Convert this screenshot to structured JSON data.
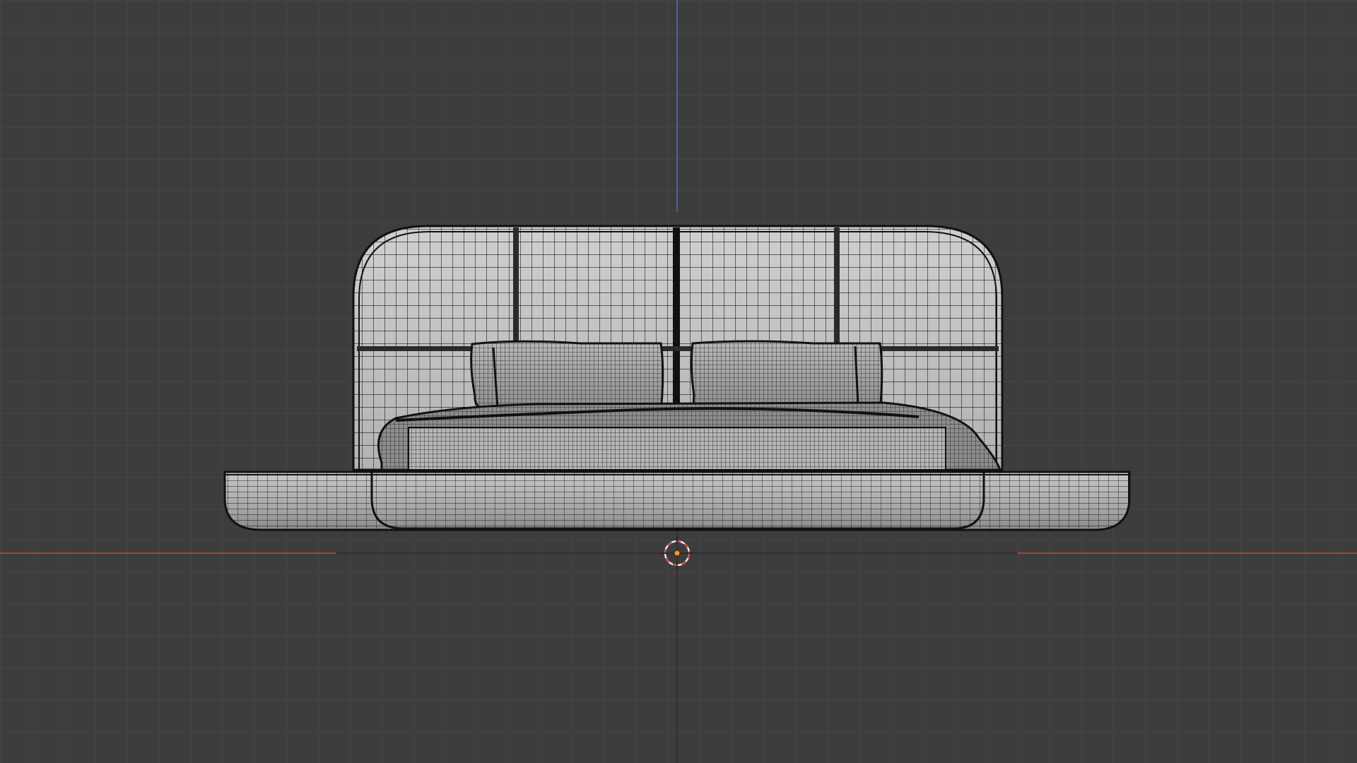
{
  "viewport": {
    "view": "front-orthographic",
    "shading": "wireframe-overlay",
    "colors": {
      "background": "#3d3d3d",
      "grid": "#4a4a4a",
      "x_axis": "#c0474c",
      "z_axis": "#4a6fb8",
      "cursor_ring": "#d84a4a",
      "origin_dot": "#ff9a1a",
      "mesh_fill": "#c4c4c4",
      "mesh_wire": "#1a1a1a"
    }
  },
  "scene": {
    "objects": [
      {
        "name": "bed-platform",
        "type": "mesh"
      },
      {
        "name": "headboard",
        "type": "mesh"
      },
      {
        "name": "mattress",
        "type": "mesh"
      },
      {
        "name": "duvet",
        "type": "mesh"
      },
      {
        "name": "pillow-left",
        "type": "mesh"
      },
      {
        "name": "pillow-right",
        "type": "mesh"
      }
    ],
    "icons": [
      "3d-cursor-icon",
      "origin-icon"
    ]
  }
}
